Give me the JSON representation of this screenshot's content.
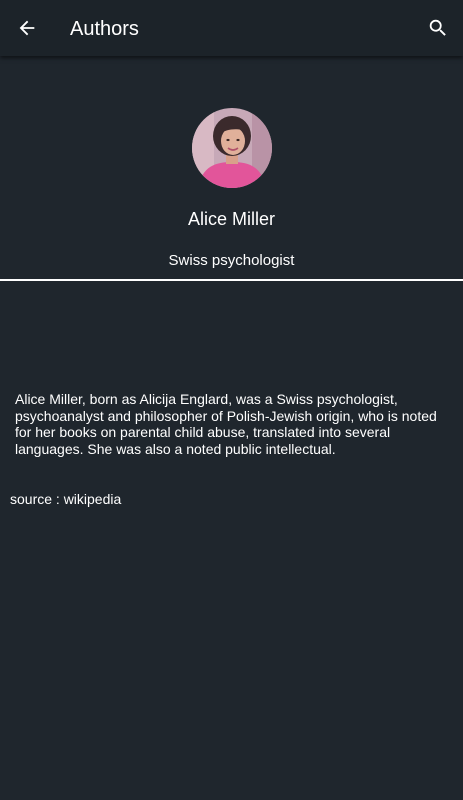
{
  "app_bar": {
    "title": "Authors",
    "back_icon": "arrow-back-icon",
    "search_icon": "search-icon"
  },
  "author": {
    "name": "Alice Miller",
    "description": "Swiss psychologist",
    "bio": "Alice Miller, born as Alicija Englard, was a Swiss psychologist, psychoanalyst and philosopher of Polish-Jewish origin, who is noted for her books on parental child abuse, translated into several languages. She was also a noted public intellectual.",
    "source": "source : wikipedia"
  },
  "colors": {
    "background": "#1f262d",
    "app_bar": "#1c2329",
    "text": "#ffffff",
    "divider": "#ffffff"
  }
}
